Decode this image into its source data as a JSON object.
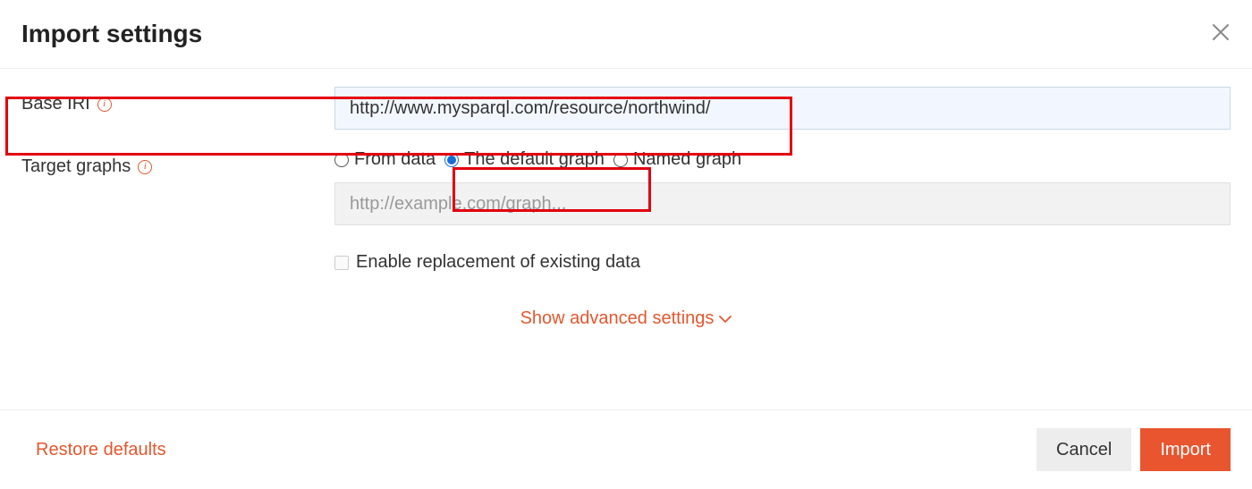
{
  "header": {
    "title": "Import settings"
  },
  "form": {
    "base_iri": {
      "label": "Base IRI",
      "value": "http://www.mysparql.com/resource/northwind/"
    },
    "target_graphs": {
      "label": "Target graphs",
      "options": {
        "from_data": "From data",
        "default_graph": "The default graph",
        "named_graph": "Named graph"
      },
      "selected": "default_graph",
      "named_graph_placeholder": "http://example.com/graph..."
    },
    "enable_replacement": {
      "label": "Enable replacement of existing data",
      "checked": false
    },
    "show_advanced": "Show advanced settings"
  },
  "footer": {
    "restore": "Restore defaults",
    "cancel": "Cancel",
    "import": "Import"
  }
}
